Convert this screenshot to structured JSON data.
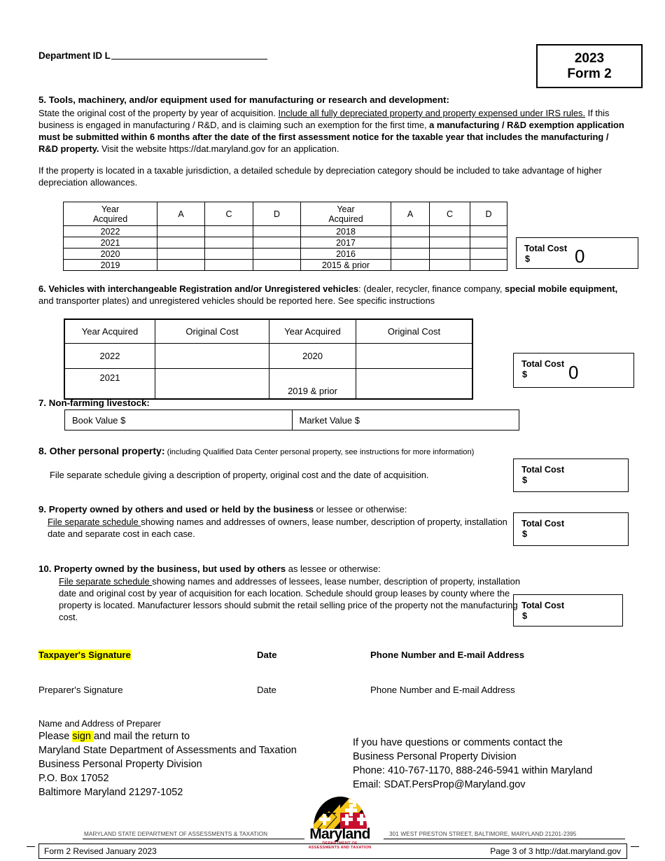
{
  "header": {
    "dept_id_label": "Department ID L",
    "form_year": "2023",
    "form_name": "Form 2"
  },
  "section5": {
    "heading": "5. Tools, machinery, and/or equipment used for manufacturing or research and development:",
    "p1_a": "State the original cost of the property by year of acquisition. ",
    "p1_b_underlined": "Include all fully depreciated property and property expensed under IRS rules.",
    "p1_c": " If this business is engaged in manufacturing / R&D, and is claiming such an exemption for the first time, ",
    "p1_d_bold": "a manufacturing / R&D exemption application must be submitted within 6 months after the date of the first assessment notice for the taxable year that includes the manufacturing / R&D property.",
    "p1_e": " Visit the website https://dat.maryland.gov for an application.",
    "p2": "If the property is located in a taxable jurisdiction, a detailed schedule by depreciation category should be included to take advantage of higher depreciation allowances.",
    "table": {
      "headers": [
        "Year Acquired",
        "A",
        "C",
        "D",
        "Year Acquired",
        "A",
        "C",
        "D"
      ],
      "header_left_line1": "Year",
      "header_left_line2": "Acquired",
      "rows": [
        {
          "left_year": "2022",
          "left_a": "",
          "left_c": "",
          "left_d": "",
          "right_year": "2018",
          "right_a": "",
          "right_c": "",
          "right_d": ""
        },
        {
          "left_year": "2021",
          "left_a": "",
          "left_c": "",
          "left_d": "",
          "right_year": "2017",
          "right_a": "",
          "right_c": "",
          "right_d": ""
        },
        {
          "left_year": "2020",
          "left_a": "",
          "left_c": "",
          "left_d": "",
          "right_year": "2016",
          "right_a": "",
          "right_c": "",
          "right_d": ""
        },
        {
          "left_year": "2019",
          "left_a": "",
          "left_c": "",
          "left_d": "",
          "right_year": "2015 & prior",
          "right_a": "",
          "right_c": "",
          "right_d": ""
        }
      ]
    },
    "total": {
      "label": "Total Cost",
      "currency": "$",
      "value": "0"
    }
  },
  "section6": {
    "heading_bold1": "6. Vehicles with interchangeable Registration and/or Unregistered vehicles",
    "heading_rest1": ": (dealer, recycler, finance company, ",
    "heading_bold2": "special mobile equipment,",
    "heading_rest2": " and transporter plates) and unregistered vehicles should be reported here. See specific instructions",
    "table": {
      "headers": [
        "Year Acquired",
        "Original Cost",
        "Year Acquired",
        "Original Cost"
      ],
      "rows": [
        {
          "left_year": "2022",
          "left_cost": "",
          "right_year": "2020",
          "right_cost": ""
        },
        {
          "left_year": "2021",
          "left_cost": "",
          "right_year": "2019 & prior",
          "right_cost": ""
        }
      ]
    },
    "total": {
      "label": "Total Cost",
      "currency": "$",
      "value": "0"
    }
  },
  "section7": {
    "heading": "7. Non-farming livestock:",
    "book_value": "Book Value $",
    "market_value": "Market Value $"
  },
  "section8": {
    "heading_bold": "8.  Other personal property:",
    "heading_note": " (including Qualified Data Center personal property, see instructions for more information)",
    "body": "File separate schedule giving a description of property, original cost and the date of acquisition.",
    "total": {
      "label": "Total Cost",
      "currency": "$",
      "value": ""
    }
  },
  "section9": {
    "heading_bold": "9. Property owned by others and used or held by the business",
    "heading_rest": " or lessee or otherwise:",
    "body_underlined": "File separate schedule ",
    "body_rest": "showing names and addresses of owners, lease number, description of property, installation date and separate cost in each case.",
    "total": {
      "label": "Total Cost",
      "currency": "$",
      "value": ""
    }
  },
  "section10": {
    "heading_bold": "10. Property owned by the business, but used by others",
    "heading_rest": " as lessee or otherwise:",
    "body_underlined": "File separate schedule ",
    "body_rest": "showing names and addresses of lessees, lease number, description of property, installation date and original cost by year of acquisition for each location. Schedule should group leases by county where the property is located. Manufacturer lessors should submit the retail selling price of the property not the manufacturing cost.",
    "total": {
      "label": "Total Cost",
      "currency": "$",
      "value": ""
    }
  },
  "signatures": {
    "taxpayer_signature": "Taxpayer's Signature",
    "taxpayer_date": "Date",
    "taxpayer_phone_email": "Phone Number and E-mail Address",
    "preparer_signature": "Preparer's Signature",
    "preparer_date": "Date",
    "preparer_phone_email": "Phone Number and E-mail Address"
  },
  "mailing": {
    "line1": "Name and Address of Preparer",
    "line2_pre": "Please ",
    "line2_highlight": "sign ",
    "line2_post": "and mail the return to",
    "line3": "Maryland State Department of Assessments and Taxation",
    "line4": "Business Personal Property Division",
    "line5": "P.O. Box 17052",
    "line6": "Baltimore Maryland 21297-1052"
  },
  "contact": {
    "line1": "If you have questions or comments contact the",
    "line2": "Business Personal Property Division",
    "line3": "Phone: 410-767-1170, 888-246-5941 within Maryland",
    "line4": "Email: SDAT.PersProp@Maryland.gov"
  },
  "logo": {
    "wordmark": "Maryland",
    "sub_line1": "DEPARTMENT OF",
    "sub_line2": "ASSESSMENTS AND TAXATION",
    "footer_left": "MARYLAND STATE DEPARTMENT OF ASSESSMENTS & TAXATION",
    "footer_right": "301 WEST PRESTON STREET, BALTIMORE, MARYLAND  21201-2395"
  },
  "footer": {
    "left": "Form 2 Revised January 2023",
    "right": "Page 3 of 3   http://dat.maryland.gov"
  },
  "colors": {
    "highlight": "#ffff00",
    "flag_gold": "#f5c518",
    "flag_red": "#c8102e",
    "flag_black": "#000000"
  }
}
